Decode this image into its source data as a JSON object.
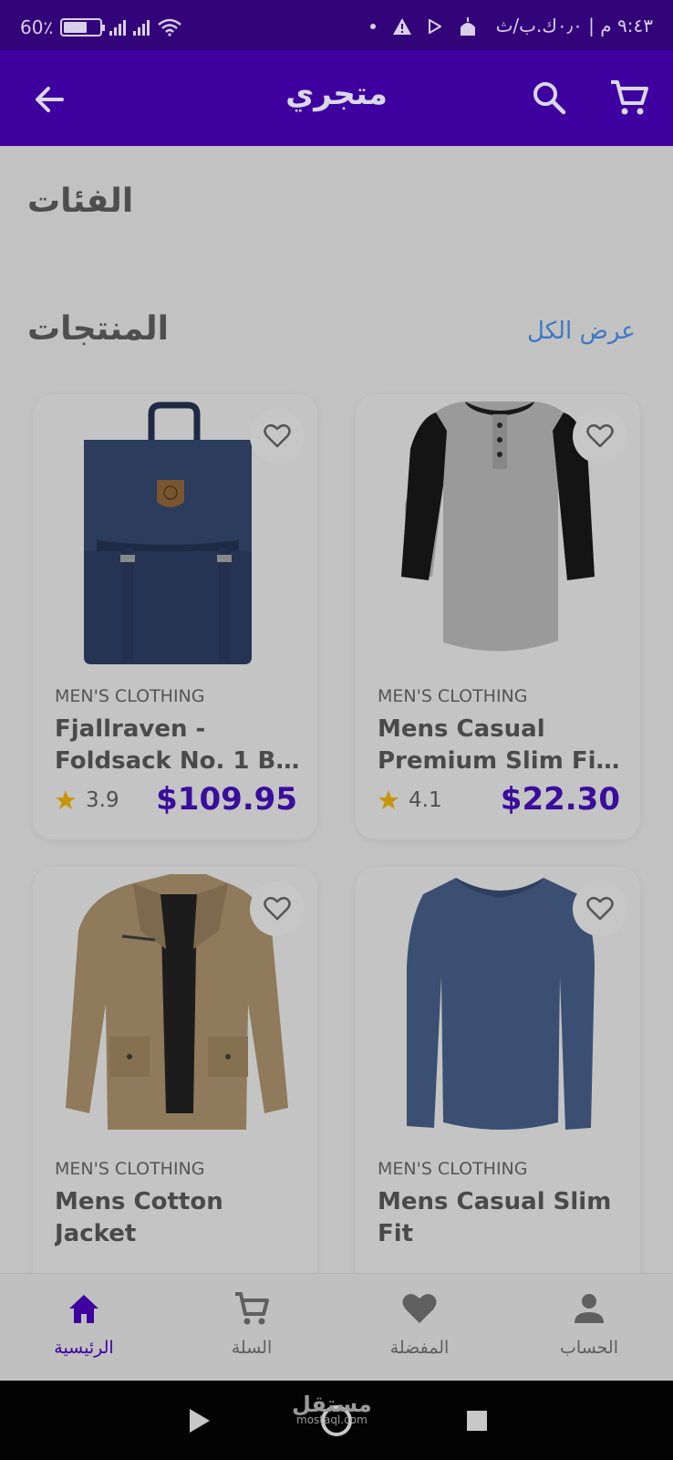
{
  "status_bar": {
    "battery": "60٪",
    "time": "٩:٤٣ م | ٠٫٠ك.ب/ث"
  },
  "app_bar": {
    "title": "متجري"
  },
  "sections": {
    "categories_title": "الفئات",
    "products_title": "المنتجات",
    "view_all": "عرض الكل"
  },
  "products": [
    {
      "category": "MEN'S CLOTHING",
      "name_line1": "Fjallraven -",
      "name_line2": "Foldsack No. 1 B...",
      "rating": "3.9",
      "price": "$109.95",
      "image": "backpack"
    },
    {
      "category": "MEN'S CLOTHING",
      "name_line1": "Mens Casual",
      "name_line2": "Premium Slim Fit...",
      "rating": "4.1",
      "price": "$22.30",
      "image": "raglan-tshirt"
    },
    {
      "category": "MEN'S CLOTHING",
      "name_line1": "Mens Cotton",
      "name_line2": "Jacket",
      "rating": "",
      "price": "",
      "image": "jacket"
    },
    {
      "category": "MEN'S CLOTHING",
      "name_line1": "Mens Casual Slim",
      "name_line2": "Fit",
      "rating": "",
      "price": "",
      "image": "longsleeve-shirt"
    }
  ],
  "bottom_nav": [
    {
      "label": "الرئيسية",
      "icon": "home-icon",
      "active": true
    },
    {
      "label": "السلة",
      "icon": "cart-icon",
      "active": false
    },
    {
      "label": "المفضلة",
      "icon": "heart-icon",
      "active": false
    },
    {
      "label": "الحساب",
      "icon": "person-icon",
      "active": false
    }
  ],
  "watermark": {
    "brand": "مستقل",
    "domain": "mostaql.com"
  },
  "colors": {
    "primary": "#3f00a0",
    "status_bar": "#33037a",
    "price": "#3a0d9c",
    "link": "#3f78c4",
    "star": "#c8960a",
    "background": "#c2c2c2"
  }
}
